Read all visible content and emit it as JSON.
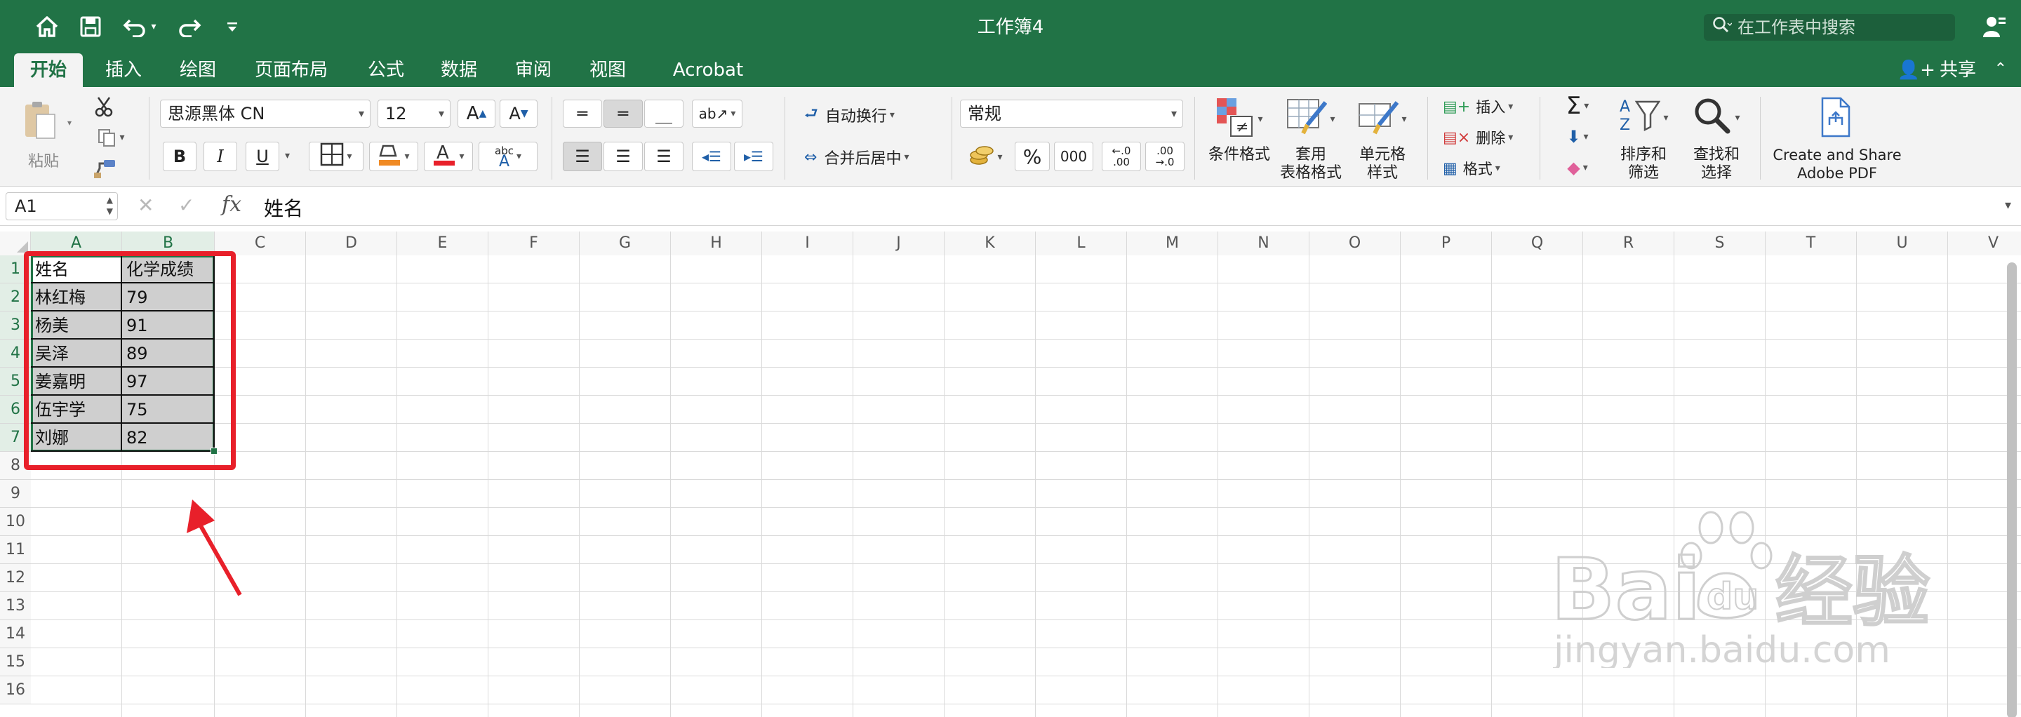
{
  "window": {
    "title": "工作簿4"
  },
  "quick_access": {
    "icons": [
      "home-icon",
      "save-icon",
      "undo-icon",
      "redo-icon",
      "customize-icon"
    ]
  },
  "search": {
    "placeholder": "在工作表中搜索"
  },
  "tabs": [
    {
      "label": "开始",
      "active": true
    },
    {
      "label": "插入"
    },
    {
      "label": "绘图"
    },
    {
      "label": "页面布局"
    },
    {
      "label": "公式"
    },
    {
      "label": "数据"
    },
    {
      "label": "审阅"
    },
    {
      "label": "视图"
    },
    {
      "label": "Acrobat"
    }
  ],
  "share": {
    "label": "共享"
  },
  "ribbon": {
    "paste_label": "粘贴",
    "font_name": "思源黑体 CN",
    "font_size": "12",
    "bold": "B",
    "italic": "I",
    "underline": "U",
    "wrap_text": "自动换行",
    "merge_center": "合并后居中",
    "number_format": "常规",
    "percent": "%",
    "thousands": "000",
    "dec_inc_a": "←.0",
    "dec_inc_b": ".00",
    "dec_dec_a": ".00",
    "dec_dec_b": "→.0",
    "cond_format": "条件格式",
    "table_format_1": "套用",
    "table_format_2": "表格格式",
    "cell_style_1": "单元格",
    "cell_style_2": "样式",
    "insert": "插入",
    "delete": "删除",
    "format": "格式",
    "sort_filter_1": "排序和",
    "sort_filter_2": "筛选",
    "find_select_1": "查找和",
    "find_select_2": "选择",
    "pdf_1": "Create and Share",
    "pdf_2": "Adobe PDF",
    "font_color": "#e8202a",
    "fill_color": "#f08a24"
  },
  "formula_bar": {
    "name_box": "A1",
    "content": "姓名",
    "fx": "fx"
  },
  "grid": {
    "columns": [
      "A",
      "B",
      "C",
      "D",
      "E",
      "F",
      "G",
      "H",
      "I",
      "J",
      "K",
      "L",
      "M",
      "N",
      "O",
      "P",
      "Q",
      "R",
      "S",
      "T",
      "U",
      "V"
    ],
    "rows": [
      "1",
      "2",
      "3",
      "4",
      "5",
      "6",
      "7",
      "8",
      "9",
      "10",
      "11",
      "12",
      "13",
      "14",
      "15",
      "16"
    ],
    "cells": [
      [
        "姓名",
        "化学成绩"
      ],
      [
        "林红梅",
        "79"
      ],
      [
        "杨美",
        "91"
      ],
      [
        "吴泽",
        "89"
      ],
      [
        "姜嘉明",
        "97"
      ],
      [
        "伍宇学",
        "75"
      ],
      [
        "刘娜",
        "82"
      ]
    ]
  },
  "watermark": {
    "brand": "Baidu经验",
    "url": "jingyan.baidu.com"
  }
}
